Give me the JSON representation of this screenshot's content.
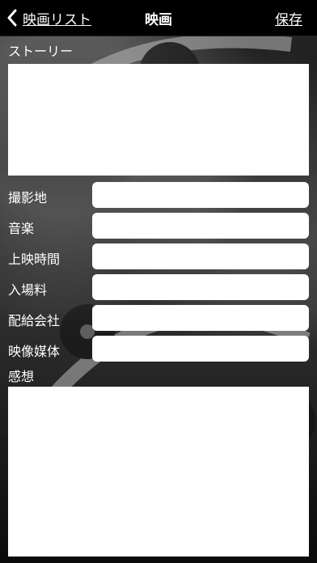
{
  "nav": {
    "back_label": "映画リスト",
    "title": "映画",
    "save_label": "保存"
  },
  "story": {
    "label": "ストーリー"
  },
  "fields": [
    {
      "label": "撮影地"
    },
    {
      "label": "音楽"
    },
    {
      "label": "上映時間"
    },
    {
      "label": "入場料"
    },
    {
      "label": "配給会社"
    },
    {
      "label": "映像媒体"
    }
  ],
  "impressions": {
    "label": "感想"
  }
}
